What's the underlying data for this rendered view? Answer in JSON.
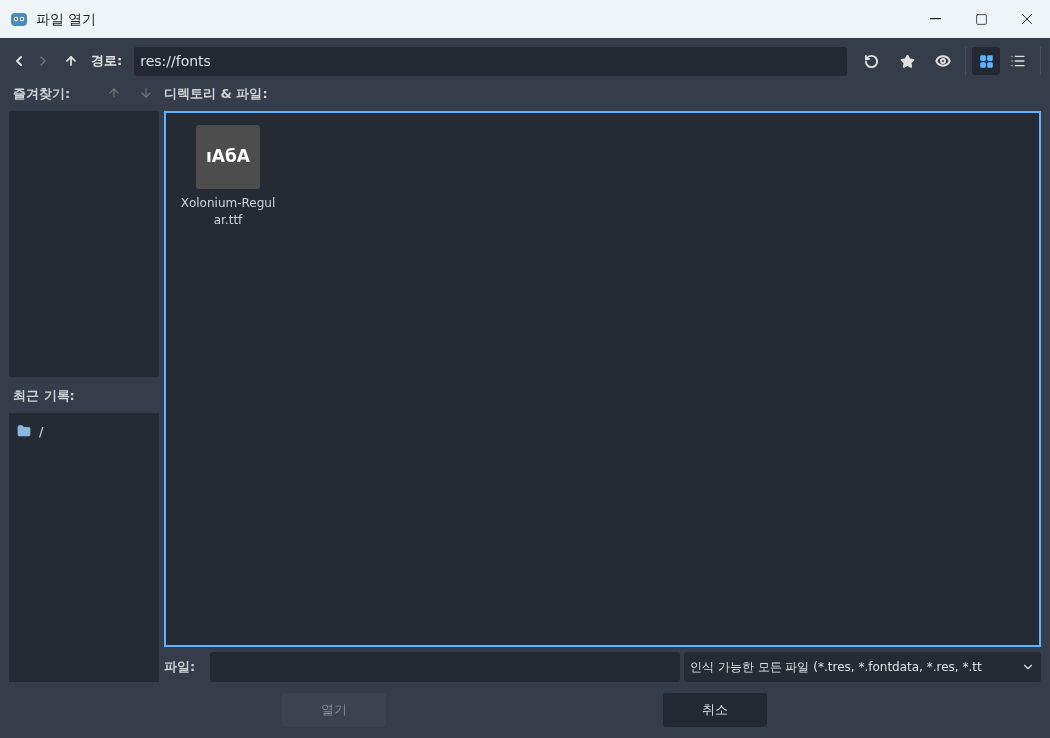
{
  "window": {
    "title": "파일 열기"
  },
  "toolbar": {
    "back_disabled": false,
    "forward_disabled": true,
    "path_label": "경로:",
    "path_value": "res://fonts",
    "view_modes": [
      {
        "kind": "grid",
        "selected": true
      },
      {
        "kind": "list",
        "selected": false
      }
    ]
  },
  "favorites": {
    "label": "즐겨찾기:"
  },
  "recent": {
    "label": "최근 기록:",
    "items": [
      {
        "name": "/"
      }
    ]
  },
  "files": {
    "label": "디렉토리 & 파일:",
    "items": [
      {
        "name": "Xolonium-Regular.ttf",
        "preview": "ıАбА"
      }
    ]
  },
  "file_field": {
    "label": "파일:"
  },
  "filter": {
    "value": "인식 가능한 모든 파일 (*.tres, *.fontdata, *.res, *.tt"
  },
  "buttons": [
    {
      "label": "열기",
      "disabled": true
    },
    {
      "label": "취소",
      "disabled": false
    }
  ]
}
